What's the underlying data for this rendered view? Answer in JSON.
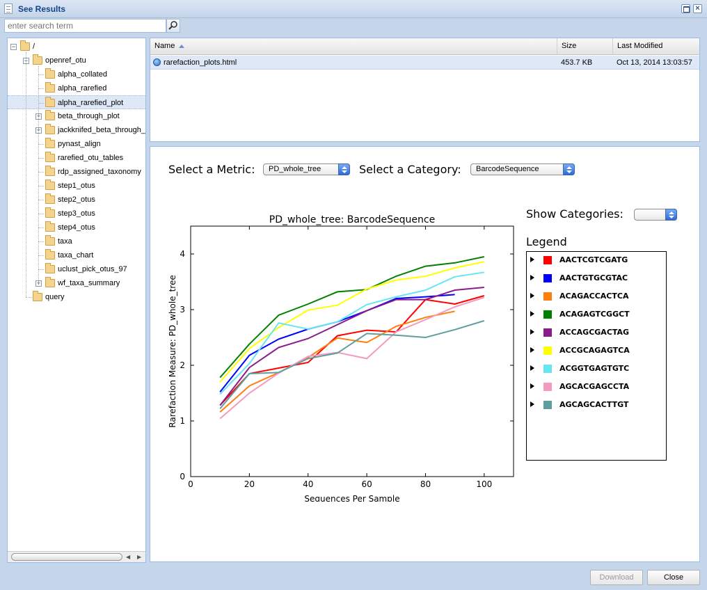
{
  "window": {
    "title": "See Results"
  },
  "search": {
    "placeholder": "enter search term"
  },
  "tree": {
    "root": "/",
    "items": [
      {
        "label": "openref_otu",
        "depth": 1,
        "expander": "minus"
      },
      {
        "label": "alpha_collated",
        "depth": 2
      },
      {
        "label": "alpha_rarefied",
        "depth": 2
      },
      {
        "label": "alpha_rarefied_plot",
        "depth": 2,
        "selected": true
      },
      {
        "label": "beta_through_plot",
        "depth": 2,
        "expander": "plus"
      },
      {
        "label": "jackknifed_beta_through_p",
        "depth": 2,
        "expander": "plus"
      },
      {
        "label": "pynast_align",
        "depth": 2
      },
      {
        "label": "rarefied_otu_tables",
        "depth": 2
      },
      {
        "label": "rdp_assigned_taxonomy",
        "depth": 2
      },
      {
        "label": "step1_otus",
        "depth": 2
      },
      {
        "label": "step2_otus",
        "depth": 2
      },
      {
        "label": "step3_otus",
        "depth": 2
      },
      {
        "label": "step4_otus",
        "depth": 2
      },
      {
        "label": "taxa",
        "depth": 2
      },
      {
        "label": "taxa_chart",
        "depth": 2
      },
      {
        "label": "uclust_pick_otus_97",
        "depth": 2
      },
      {
        "label": "wf_taxa_summary",
        "depth": 2,
        "expander": "plus"
      },
      {
        "label": "query",
        "depth": 1
      }
    ]
  },
  "files": {
    "columns": [
      "Name",
      "Size",
      "Last Modified"
    ],
    "rows": [
      {
        "name": "rarefaction_plots.html",
        "size": "453.7 KB",
        "modified": "Oct 13, 2014 13:03:57"
      }
    ]
  },
  "viewer": {
    "metric_label": "Select a Metric:",
    "metric_value": "PD_whole_tree",
    "category_label": "Select a Category:",
    "category_value": "BarcodeSequence",
    "show_categories_label": "Show Categories:",
    "show_categories_value": "",
    "legend_title": "Legend"
  },
  "chart_data": {
    "type": "line",
    "title": "PD_whole_tree: BarcodeSequence",
    "xlabel": "Sequences Per Sample",
    "ylabel": "Rarefaction Measure: PD_whole_tree",
    "xlim": [
      0,
      110
    ],
    "ylim": [
      0,
      4.5
    ],
    "xticks": [
      0,
      20,
      40,
      60,
      80,
      100
    ],
    "yticks": [
      0,
      1,
      2,
      3,
      4
    ],
    "x": [
      10,
      20,
      30,
      40,
      50,
      60,
      70,
      80,
      90,
      100
    ],
    "series": [
      {
        "name": "AACTCGTCGATG",
        "color": "#ff0000",
        "values": [
          1.28,
          1.85,
          1.95,
          2.05,
          2.53,
          2.63,
          2.6,
          3.18,
          3.1,
          3.25
        ]
      },
      {
        "name": "AACTGTGCGTAC",
        "color": "#0000ff",
        "values": [
          1.52,
          2.18,
          2.47,
          2.65,
          2.78,
          2.98,
          3.2,
          3.23,
          3.27,
          null
        ]
      },
      {
        "name": "ACAGACCACTCA",
        "color": "#ff7f0e",
        "values": [
          1.16,
          1.63,
          1.87,
          2.14,
          2.49,
          2.41,
          2.7,
          2.86,
          2.97,
          null
        ]
      },
      {
        "name": "ACAGAGTCGGCT",
        "color": "#008000",
        "values": [
          1.78,
          2.38,
          2.9,
          3.1,
          3.32,
          3.36,
          3.6,
          3.78,
          3.84,
          3.95
        ]
      },
      {
        "name": "ACCAGCGACTAG",
        "color": "#8b1a8b",
        "values": [
          1.28,
          1.96,
          2.32,
          2.48,
          2.73,
          2.98,
          3.18,
          3.18,
          3.35,
          3.4
        ]
      },
      {
        "name": "ACCGCAGAGTCA",
        "color": "#ffff00",
        "values": [
          1.7,
          2.3,
          2.68,
          2.99,
          3.08,
          3.37,
          3.53,
          3.6,
          3.75,
          3.86
        ]
      },
      {
        "name": "ACGGTGAGTGTC",
        "color": "#66e6f2",
        "values": [
          1.48,
          2.03,
          2.76,
          2.65,
          2.78,
          3.09,
          3.23,
          3.35,
          3.59,
          3.67
        ]
      },
      {
        "name": "AGCACGAGCCTA",
        "color": "#f49ac1",
        "values": [
          1.04,
          1.5,
          1.86,
          2.16,
          2.23,
          2.12,
          2.6,
          2.82,
          3.05,
          3.22
        ]
      },
      {
        "name": "AGCAGCACTTGT",
        "color": "#5f9ea0",
        "values": [
          1.22,
          1.85,
          1.87,
          2.12,
          2.22,
          2.57,
          2.54,
          2.5,
          2.64,
          2.8
        ]
      }
    ],
    "grid": false,
    "legend": "right"
  },
  "buttons": {
    "download": "Download",
    "close": "Close"
  }
}
